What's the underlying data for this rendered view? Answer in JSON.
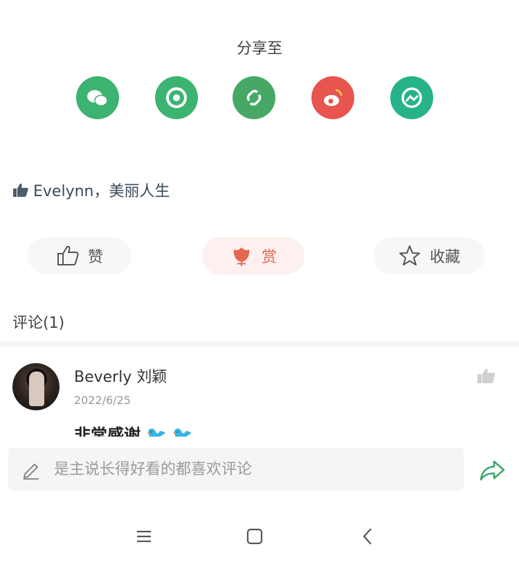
{
  "share": {
    "title": "分享至",
    "targets": [
      {
        "icon": "wechat-icon",
        "color": "#3cb371"
      },
      {
        "icon": "moments-icon",
        "color": "#3cb371"
      },
      {
        "icon": "link-icon",
        "color": "#3cb371"
      },
      {
        "icon": "weibo-icon",
        "color": "#e8544e"
      },
      {
        "icon": "qzone-icon",
        "color": "#26b38a"
      }
    ]
  },
  "likes": {
    "text": "Evelynn，美丽人生"
  },
  "actions": {
    "like_label": "赞",
    "reward_label": "赏",
    "favorite_label": "收藏"
  },
  "comments": {
    "title": "评论(1)",
    "items": [
      {
        "name": "Beverly 刘颖",
        "date": "2022/6/25",
        "text": "非常感谢"
      }
    ]
  },
  "comment_input": {
    "placeholder": "是主说长得好看的都喜欢评论"
  },
  "colors": {
    "accent": "#e4684f",
    "share_green": "#3cb371",
    "input_bg": "#f5f5f5"
  }
}
